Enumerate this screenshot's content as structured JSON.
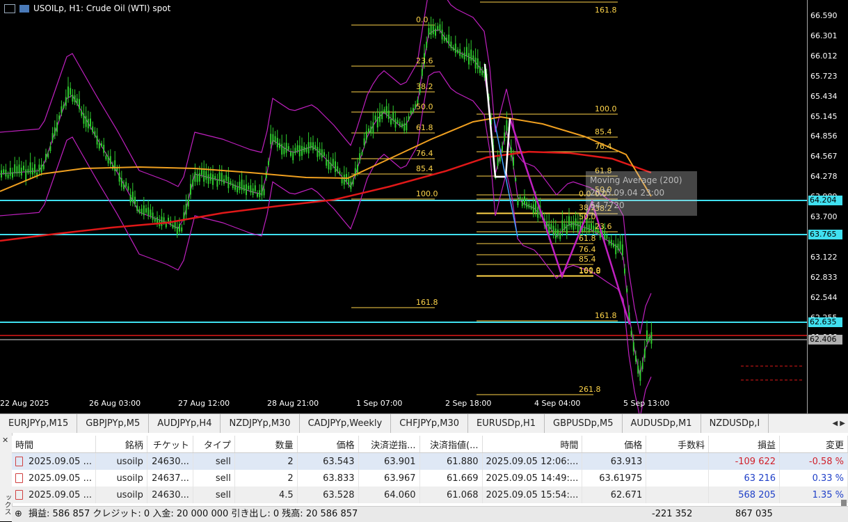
{
  "chart": {
    "title": "USOILp, H1:  Crude Oil (WTI) spot",
    "price_labels": [
      "66.590",
      "66.301",
      "66.012",
      "65.723",
      "65.434",
      "65.145",
      "64.856",
      "64.567",
      "64.278",
      "63.989",
      "63.700",
      "63.411",
      "63.122",
      "62.833",
      "62.544",
      "62.255",
      "61.966"
    ],
    "price_boxes": {
      "upper": "64.204",
      "mid": "63.765",
      "lower": "62.635",
      "current": "62.406"
    },
    "time_labels": [
      "22 Aug 2025",
      "26 Aug 03:00",
      "27 Aug 12:00",
      "28 Aug 21:00",
      "1 Sep 07:00",
      "2 Sep 18:00",
      "4 Sep 04:00",
      "5 Sep 13:00"
    ],
    "fib_left": [
      "0.0",
      "23.6",
      "38.2",
      "50.0",
      "61.8",
      "76.4",
      "85.4",
      "100.0",
      "161.8"
    ],
    "fib_mid": [
      "100.0",
      "85.4",
      "76.4",
      "61.8",
      "50.0",
      "38.2",
      "23.6",
      "0.0",
      "161.8"
    ],
    "fib_right": [
      "0.0",
      "38.2",
      "50.0",
      "61.8",
      "76.4",
      "85.4",
      "100.0",
      "161.8",
      "261.8"
    ],
    "fib_top": "161.8",
    "tooltip": [
      "Moving Average (200)",
      "2025.09.04 23:00",
      "64.7720"
    ],
    "colors": {
      "candles": "#2ecc2e",
      "bollinger": "#c020c0",
      "ma_long": "#e01818",
      "ma_mid": "#f0a020",
      "hline": "#40e0f0",
      "fib": "#ffd54a"
    }
  },
  "tabs": [
    "EURJPYp,M15",
    "GBPJPYp,M5",
    "AUDJPYp,H4",
    "NZDJPYp,M30",
    "CADJPYp,Weekly",
    "CHFJPYp,M30",
    "EURUSDp,H1",
    "GBPUSDp,M5",
    "AUDUSDp,M1",
    "NZDUSDp,I"
  ],
  "table": {
    "headers": [
      "時間",
      "銘柄",
      "チケット",
      "タイプ",
      "数量",
      "価格",
      "決済逆指...",
      "決済指値(...",
      "時間",
      "価格",
      "手数料",
      "損益",
      "変更"
    ],
    "rows": [
      [
        "2025.09.05 ...",
        "usoilp",
        "24630...",
        "sell",
        "2",
        "63.543",
        "63.901",
        "61.880",
        "2025.09.05 12:06:...",
        "63.913",
        "",
        "-109 622",
        "-0.58 %"
      ],
      [
        "2025.09.05 ...",
        "usoilp",
        "24637...",
        "sell",
        "2",
        "63.833",
        "63.967",
        "61.669",
        "2025.09.05 14:49:...",
        "63.61975",
        "",
        "63 216",
        "0.33 %"
      ],
      [
        "2025.09.05 ...",
        "usoilp",
        "24630...",
        "sell",
        "4.5",
        "63.528",
        "64.060",
        "61.068",
        "2025.09.05 15:54:...",
        "62.671",
        "",
        "568 205",
        "1.35 %"
      ]
    ],
    "summary": "損益: 586 857  クレジット: 0  入金: 20 000 000  引き出し: 0  残高: 20 586 857",
    "summary_v1": "-221 352",
    "summary_v2": "867 035",
    "side_label": "ックス"
  }
}
